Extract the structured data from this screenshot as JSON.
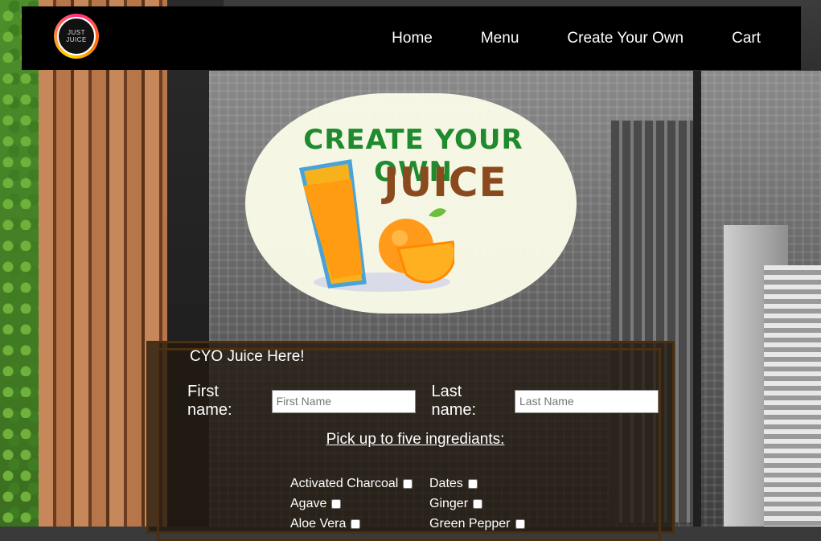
{
  "nav": {
    "logo_text": "JUST JUICE",
    "links": [
      "Home",
      "Menu",
      "Create Your Own",
      "Cart"
    ]
  },
  "hero": {
    "line1": "CREATE YOUR OWN",
    "line2": "JUICE"
  },
  "form": {
    "legend": "CYO Juice Here!",
    "first_name_label": "First name:",
    "first_name_placeholder": "First Name",
    "last_name_label": "Last name:",
    "last_name_placeholder": "Last Name",
    "ingredients_heading": "Pick up to five ingrediants:",
    "ingredients_left": [
      "Activated Charcoal",
      "Agave",
      "Aloe Vera"
    ],
    "ingredients_right": [
      "Dates",
      "Ginger",
      "Green Pepper"
    ]
  },
  "colors": {
    "nav_bg": "#000000",
    "hero_green": "#1f8a2e",
    "hero_brown": "#8a4a1d",
    "panel_border": "#4a2f10"
  }
}
